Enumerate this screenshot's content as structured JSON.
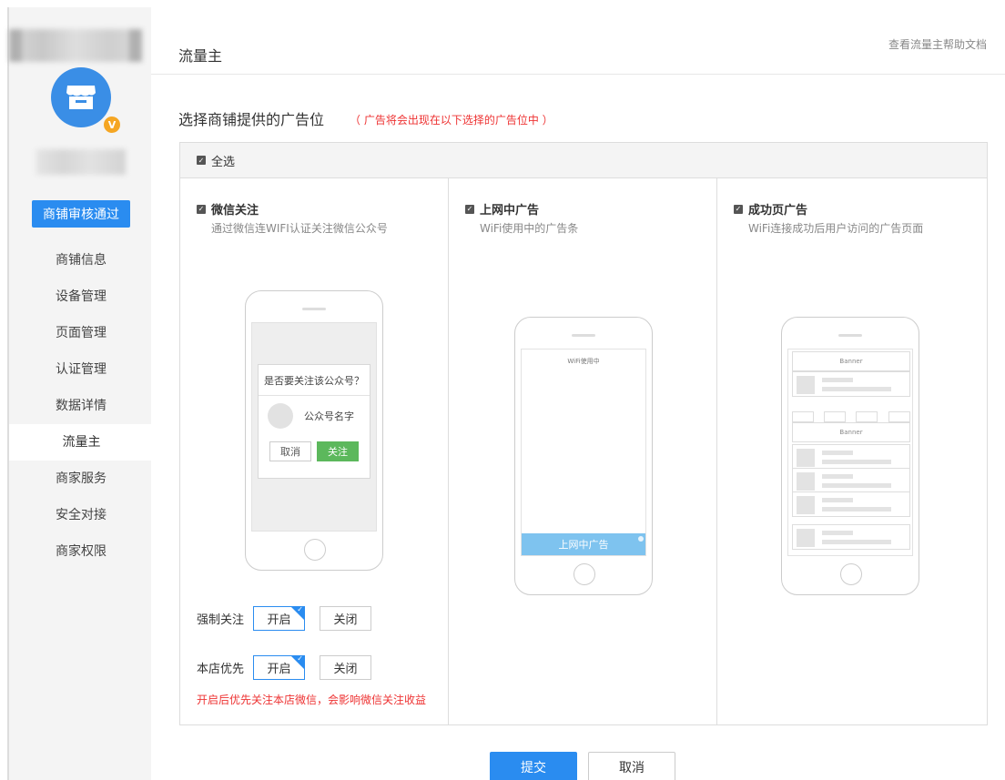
{
  "sidebar": {
    "badge": "商铺审核通过",
    "vip_badge": "V",
    "items": [
      {
        "label": "商铺信息"
      },
      {
        "label": "设备管理"
      },
      {
        "label": "页面管理"
      },
      {
        "label": "认证管理"
      },
      {
        "label": "数据详情"
      },
      {
        "label": "流量主",
        "active": true
      },
      {
        "label": "商家服务"
      },
      {
        "label": "安全对接"
      },
      {
        "label": "商家权限"
      }
    ]
  },
  "header": {
    "title": "流量主",
    "help_link": "查看流量主帮助文档"
  },
  "main": {
    "section_title": "选择商铺提供的广告位",
    "section_hint": "（ 广告将会出现在以下选择的广告位中 ）",
    "select_all": "全选",
    "columns": [
      {
        "title": "微信关注",
        "desc": "通过微信连WIFI认证关注微信公众号",
        "checked": true
      },
      {
        "title": "上网中广告",
        "desc": "WiFi使用中的广告条",
        "checked": true
      },
      {
        "title": "成功页广告",
        "desc": "WiFi连接成功后用户访问的广告页面",
        "checked": true
      }
    ],
    "phone1": {
      "question": "是否要关注该公众号？",
      "account_name": "公众号名字",
      "cancel": "取消",
      "follow": "关注"
    },
    "phone2": {
      "screen_label": "WiFi使用中",
      "ad_bar": "上网中广告"
    },
    "phone3": {
      "banner1": "Banner",
      "banner2": "Banner"
    },
    "force_follow": {
      "label": "强制关注",
      "on": "开启",
      "off": "关闭",
      "selected": "on"
    },
    "shop_first": {
      "label": "本店优先",
      "on": "开启",
      "off": "关闭",
      "selected": "on"
    },
    "warning": "开启后优先关注本店微信，会影响微信关注收益"
  },
  "footer": {
    "submit": "提交",
    "cancel": "取消"
  },
  "colors": {
    "primary": "#2a8cf0",
    "warning": "#e33333",
    "follow_green": "#5cb85c",
    "ad_bar": "#7ec3ef",
    "vip": "#f5a623"
  }
}
